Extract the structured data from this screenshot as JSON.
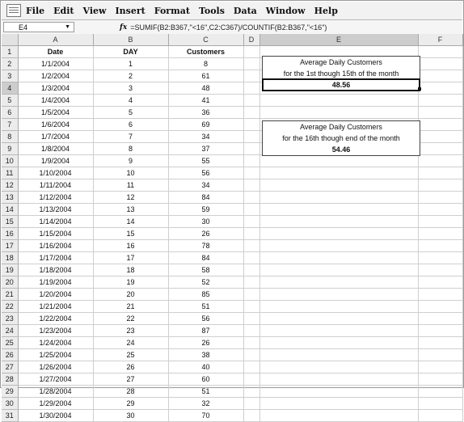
{
  "menu": [
    "File",
    "Edit",
    "View",
    "Insert",
    "Format",
    "Tools",
    "Data",
    "Window",
    "Help"
  ],
  "formula_bar": {
    "name_box": "E4",
    "fx": "fx",
    "formula": "=SUMIF(B2:B367,\"<16\",C2:C367)/COUNTIF(B2:B367,\"<16\")"
  },
  "columns": [
    "A",
    "B",
    "C",
    "D",
    "E",
    "F"
  ],
  "headers": {
    "date": "Date",
    "day": "DAY",
    "customers": "Customers"
  },
  "rows": [
    {
      "n": "2",
      "date": "1/1/2004",
      "day": "1",
      "cust": "8"
    },
    {
      "n": "3",
      "date": "1/2/2004",
      "day": "2",
      "cust": "61"
    },
    {
      "n": "4",
      "date": "1/3/2004",
      "day": "3",
      "cust": "48"
    },
    {
      "n": "5",
      "date": "1/4/2004",
      "day": "4",
      "cust": "41"
    },
    {
      "n": "6",
      "date": "1/5/2004",
      "day": "5",
      "cust": "36"
    },
    {
      "n": "7",
      "date": "1/6/2004",
      "day": "6",
      "cust": "69"
    },
    {
      "n": "8",
      "date": "1/7/2004",
      "day": "7",
      "cust": "34"
    },
    {
      "n": "9",
      "date": "1/8/2004",
      "day": "8",
      "cust": "37"
    },
    {
      "n": "10",
      "date": "1/9/2004",
      "day": "9",
      "cust": "55"
    },
    {
      "n": "11",
      "date": "1/10/2004",
      "day": "10",
      "cust": "56"
    },
    {
      "n": "12",
      "date": "1/11/2004",
      "day": "11",
      "cust": "34"
    },
    {
      "n": "13",
      "date": "1/12/2004",
      "day": "12",
      "cust": "84"
    },
    {
      "n": "14",
      "date": "1/13/2004",
      "day": "13",
      "cust": "59"
    },
    {
      "n": "15",
      "date": "1/14/2004",
      "day": "14",
      "cust": "30"
    },
    {
      "n": "16",
      "date": "1/15/2004",
      "day": "15",
      "cust": "26"
    },
    {
      "n": "17",
      "date": "1/16/2004",
      "day": "16",
      "cust": "78"
    },
    {
      "n": "18",
      "date": "1/17/2004",
      "day": "17",
      "cust": "84"
    },
    {
      "n": "19",
      "date": "1/18/2004",
      "day": "18",
      "cust": "58"
    },
    {
      "n": "20",
      "date": "1/19/2004",
      "day": "19",
      "cust": "52"
    },
    {
      "n": "21",
      "date": "1/20/2004",
      "day": "20",
      "cust": "85"
    },
    {
      "n": "22",
      "date": "1/21/2004",
      "day": "21",
      "cust": "51"
    },
    {
      "n": "23",
      "date": "1/22/2004",
      "day": "22",
      "cust": "56"
    },
    {
      "n": "24",
      "date": "1/23/2004",
      "day": "23",
      "cust": "87"
    },
    {
      "n": "25",
      "date": "1/24/2004",
      "day": "24",
      "cust": "26"
    },
    {
      "n": "26",
      "date": "1/25/2004",
      "day": "25",
      "cust": "38"
    },
    {
      "n": "27",
      "date": "1/26/2004",
      "day": "26",
      "cust": "40"
    },
    {
      "n": "28",
      "date": "1/27/2004",
      "day": "27",
      "cust": "60"
    },
    {
      "n": "29",
      "date": "1/28/2004",
      "day": "28",
      "cust": "51"
    },
    {
      "n": "30",
      "date": "1/29/2004",
      "day": "29",
      "cust": "32"
    },
    {
      "n": "31",
      "date": "1/30/2004",
      "day": "30",
      "cust": "70"
    }
  ],
  "box1": {
    "line1": "Average Daily Customers",
    "line2": "for the 1st though 15th of the month",
    "value": "48.56"
  },
  "box2": {
    "line1": "Average Daily Customers",
    "line2": "for the 16th though end of the month",
    "value": "54.46"
  }
}
